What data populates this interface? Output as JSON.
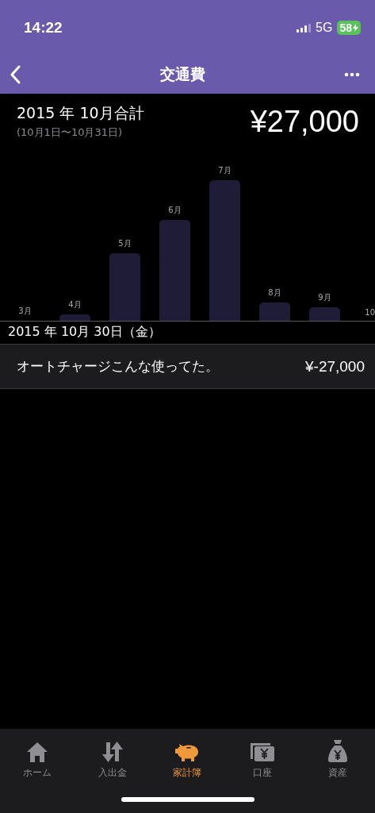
{
  "status_bar": {
    "time": "14:22",
    "network": "5G",
    "battery": "58"
  },
  "nav": {
    "title": "交通費"
  },
  "summary": {
    "title": "2015 年 10月合計",
    "period": "(10月1日〜10月31日)",
    "total": "¥27,000"
  },
  "bars": [
    {
      "label": "3月"
    },
    {
      "label": "4月"
    },
    {
      "label": "5月"
    },
    {
      "label": "6月"
    },
    {
      "label": "7月"
    },
    {
      "label": "8月"
    },
    {
      "label": "9月"
    },
    {
      "label": "10"
    }
  ],
  "sections": [
    {
      "date": "2015 年 10月 30日（金）",
      "entries": [
        {
          "memo": "オートチャージこんな使ってた。",
          "amount": "¥-27,000"
        }
      ]
    }
  ],
  "tabs": [
    {
      "kind": "home",
      "label": "ホーム",
      "selected": false
    },
    {
      "kind": "transfer",
      "label": "入出金",
      "selected": false
    },
    {
      "kind": "piggy",
      "label": "家計簿",
      "selected": true
    },
    {
      "kind": "account",
      "label": "口座",
      "selected": false
    },
    {
      "kind": "bag",
      "label": "資産",
      "selected": false
    }
  ]
}
